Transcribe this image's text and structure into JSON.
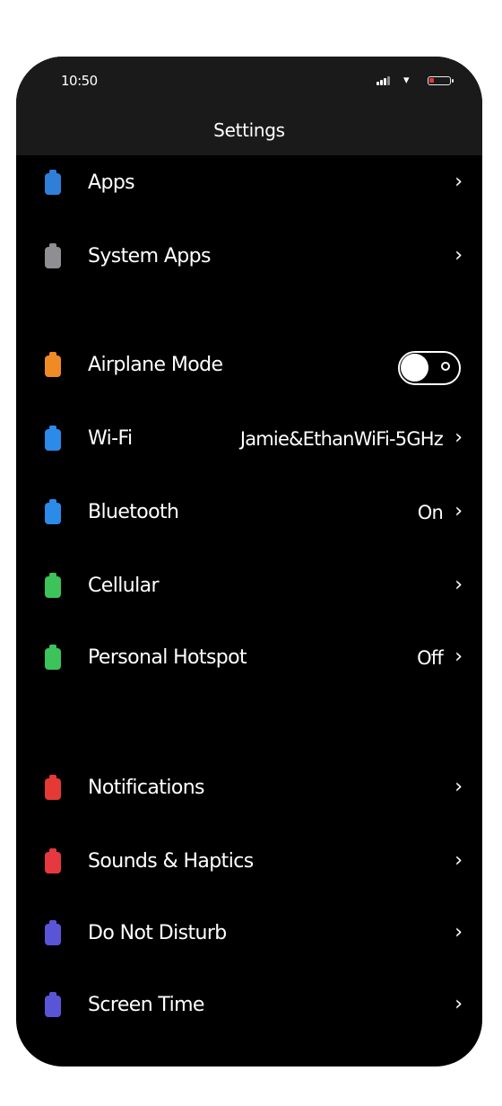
{
  "status_bar": {
    "time": "10:50",
    "battery_color": "#e53935"
  },
  "header": {
    "title": "Settings"
  },
  "sections": [
    [
      {
        "label": "Apps",
        "icon": "app-store-icon",
        "color": "#2f7fd8",
        "value": "",
        "control": "chevron"
      },
      {
        "label": "System Apps",
        "icon": "gear-icon",
        "color": "#8e8e93",
        "value": "",
        "control": "chevron"
      }
    ],
    [
      {
        "label": "Airplane Mode",
        "icon": "airplane-icon",
        "color": "#f08a24",
        "value": "",
        "control": "toggle",
        "toggle_on": false
      },
      {
        "label": "Wi-Fi",
        "icon": "wifi-icon",
        "color": "#2c8ae8",
        "value": "Jamie&EthanWiFi-5GHz",
        "control": "chevron"
      },
      {
        "label": "Bluetooth",
        "icon": "bluetooth-icon",
        "color": "#2c8ae8",
        "value": "On",
        "control": "chevron"
      },
      {
        "label": "Cellular",
        "icon": "cellular-icon",
        "color": "#3cc35a",
        "value": "",
        "control": "chevron"
      },
      {
        "label": "Personal Hotspot",
        "icon": "hotspot-icon",
        "color": "#3cc35a",
        "value": "Off",
        "control": "chevron"
      }
    ],
    [
      {
        "label": "Notifications",
        "icon": "notifications-icon",
        "color": "#e53935",
        "value": "",
        "control": "chevron"
      },
      {
        "label": "Sounds & Haptics",
        "icon": "speaker-icon",
        "color": "#e5393f",
        "value": "",
        "control": "chevron"
      },
      {
        "label": "Do Not Disturb",
        "icon": "moon-icon",
        "color": "#5a55d6",
        "value": "",
        "control": "chevron"
      },
      {
        "label": "Screen Time",
        "icon": "hourglass-icon",
        "color": "#5a55d6",
        "value": "",
        "control": "chevron"
      }
    ]
  ]
}
